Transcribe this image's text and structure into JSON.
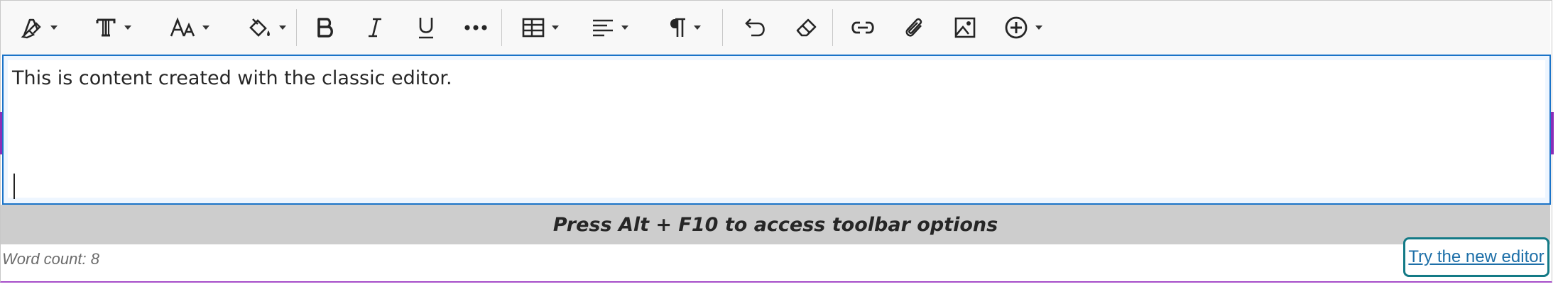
{
  "toolbar": {
    "buttons": [
      {
        "name": "text-color-icon",
        "has_dropdown": true
      },
      {
        "name": "text-style-icon",
        "has_dropdown": true
      },
      {
        "name": "font-size-icon",
        "has_dropdown": true
      },
      {
        "name": "highlight-color-icon",
        "has_dropdown": true
      },
      {
        "name": "bold-icon",
        "has_dropdown": false
      },
      {
        "name": "italic-icon",
        "has_dropdown": false
      },
      {
        "name": "underline-icon",
        "has_dropdown": false
      },
      {
        "name": "more-icon",
        "has_dropdown": false
      },
      {
        "name": "table-icon",
        "has_dropdown": true
      },
      {
        "name": "align-icon",
        "has_dropdown": true
      },
      {
        "name": "paragraph-icon",
        "has_dropdown": true
      },
      {
        "name": "undo-icon",
        "has_dropdown": false
      },
      {
        "name": "clear-format-icon",
        "has_dropdown": false
      },
      {
        "name": "link-icon",
        "has_dropdown": false
      },
      {
        "name": "attach-icon",
        "has_dropdown": false
      },
      {
        "name": "image-icon",
        "has_dropdown": false
      },
      {
        "name": "insert-content-icon",
        "has_dropdown": true
      }
    ]
  },
  "editor": {
    "content": "This is content created with the classic editor."
  },
  "status": {
    "hint": "Press Alt + F10 to access toolbar options"
  },
  "footer": {
    "word_count": "Word count: 8",
    "try_new_editor": "Try the new editor"
  },
  "colors": {
    "editor_border": "#1a73c8",
    "status_bg": "#cdcdcd",
    "accent_purple": "#8a2db8",
    "focus_ring": "#137a86",
    "link": "#1d6fa8"
  }
}
